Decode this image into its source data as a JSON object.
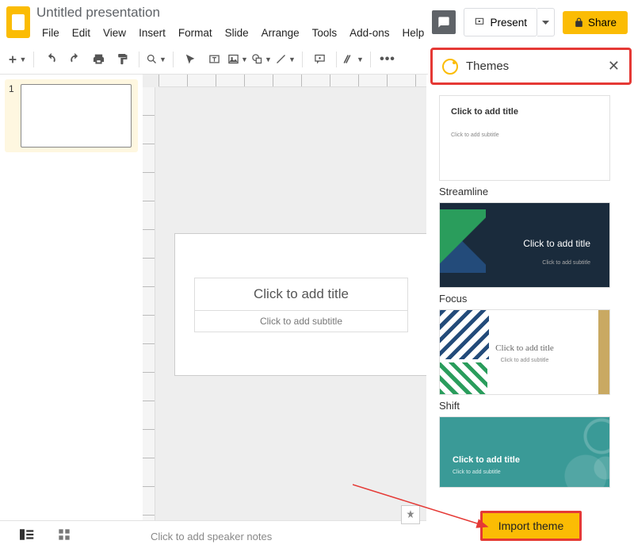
{
  "doc_title": "Untitled presentation",
  "menubar": [
    "File",
    "Edit",
    "View",
    "Insert",
    "Format",
    "Slide",
    "Arrange",
    "Tools",
    "Add-ons",
    "Help"
  ],
  "hdr": {
    "present": "Present",
    "share": "Share"
  },
  "slide": {
    "title_ph": "Click to add title",
    "sub_ph": "Click to add subtitle"
  },
  "notes_ph": "Click to add speaker notes",
  "thumb_num": "1",
  "side": {
    "title": "Themes",
    "import": "Import theme"
  },
  "themes": {
    "t1": {
      "name": "Streamline",
      "title": "Click to add title",
      "sub": "Click to add subtitle"
    },
    "t2": {
      "name": "Focus",
      "title": "Click to add title",
      "sub": "Click to add subtitle"
    },
    "t3": {
      "name": "Shift",
      "title": "Click to add title",
      "sub": "Click to add subtitle"
    },
    "t4": {
      "name": "",
      "title": "Click to add title",
      "sub": "Click to add subtitle"
    }
  }
}
